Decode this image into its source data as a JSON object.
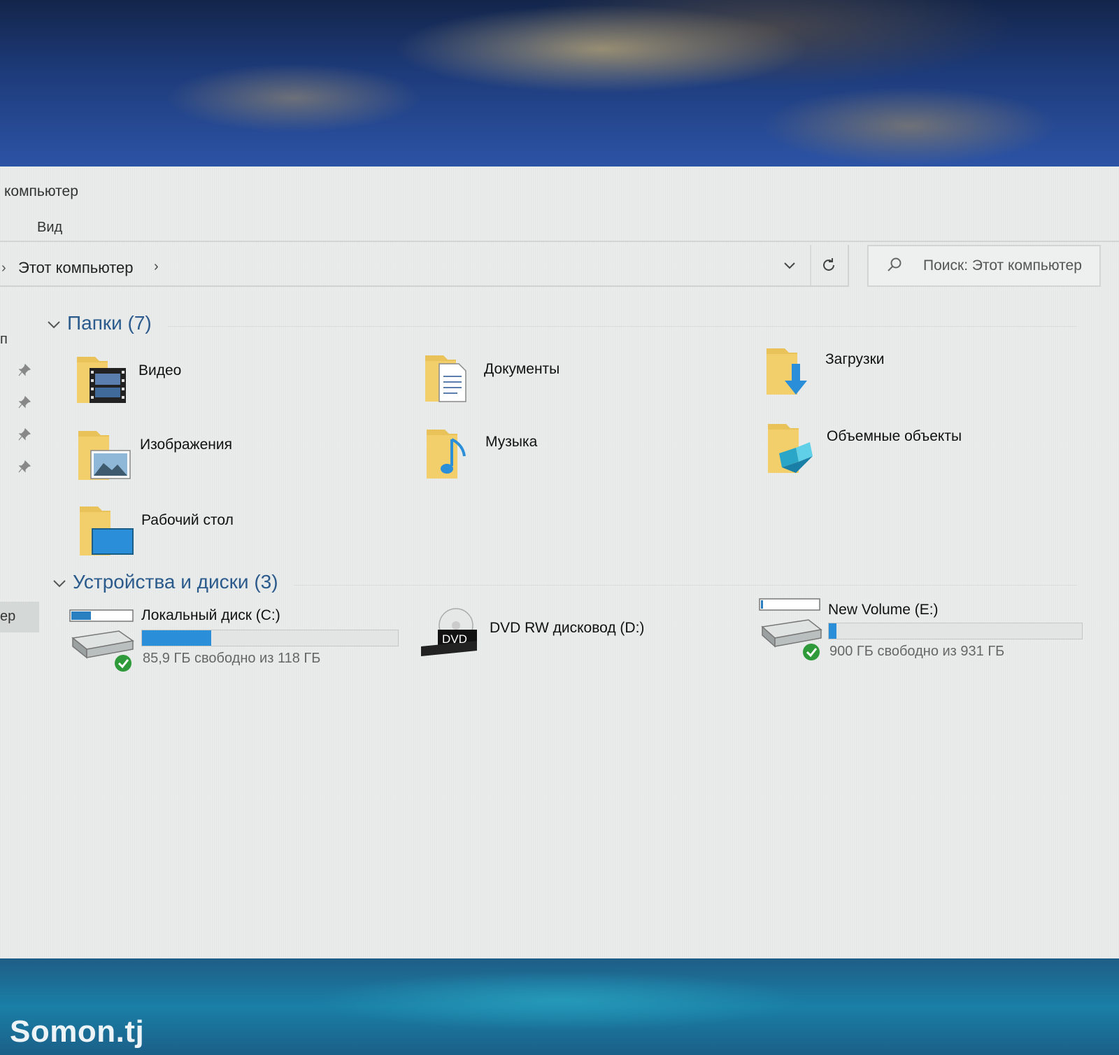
{
  "window": {
    "title": "компьютер",
    "ribbon_tab": "Вид"
  },
  "address": {
    "path": "Этот компьютер",
    "chevron": "›"
  },
  "search": {
    "placeholder": "Поиск: Этот компьютер"
  },
  "nav": {
    "fragment_top": "п",
    "selected_fragment": "ер"
  },
  "folders": {
    "header": "Папки (7)",
    "items": [
      {
        "label": "Видео",
        "icon": "video-folder-icon"
      },
      {
        "label": "Документы",
        "icon": "documents-folder-icon"
      },
      {
        "label": "Загрузки",
        "icon": "downloads-folder-icon"
      },
      {
        "label": "Изображения",
        "icon": "pictures-folder-icon"
      },
      {
        "label": "Музыка",
        "icon": "music-folder-icon"
      },
      {
        "label": "Объемные объекты",
        "icon": "3d-objects-folder-icon"
      },
      {
        "label": "Рабочий стол",
        "icon": "desktop-folder-icon"
      }
    ]
  },
  "devices": {
    "header": "Устройства и диски (3)",
    "items": [
      {
        "label": "Локальный диск (C:)",
        "free_text": "85,9 ГБ свободно из 118 ГБ",
        "used_fraction": 0.27,
        "icon": "system-drive-icon"
      },
      {
        "label": "DVD RW дисковод (D:)",
        "icon": "dvd-drive-icon",
        "dvd_badge": "DVD"
      },
      {
        "label": "New Volume (E:)",
        "free_text": "900 ГБ свободно из 931 ГБ",
        "used_fraction": 0.03,
        "icon": "hard-drive-icon"
      }
    ]
  },
  "watermark": "Somon.tj",
  "colors": {
    "accent": "#2a8fd8",
    "folder": "#e9c25a",
    "group_header": "#2b5a8c"
  }
}
